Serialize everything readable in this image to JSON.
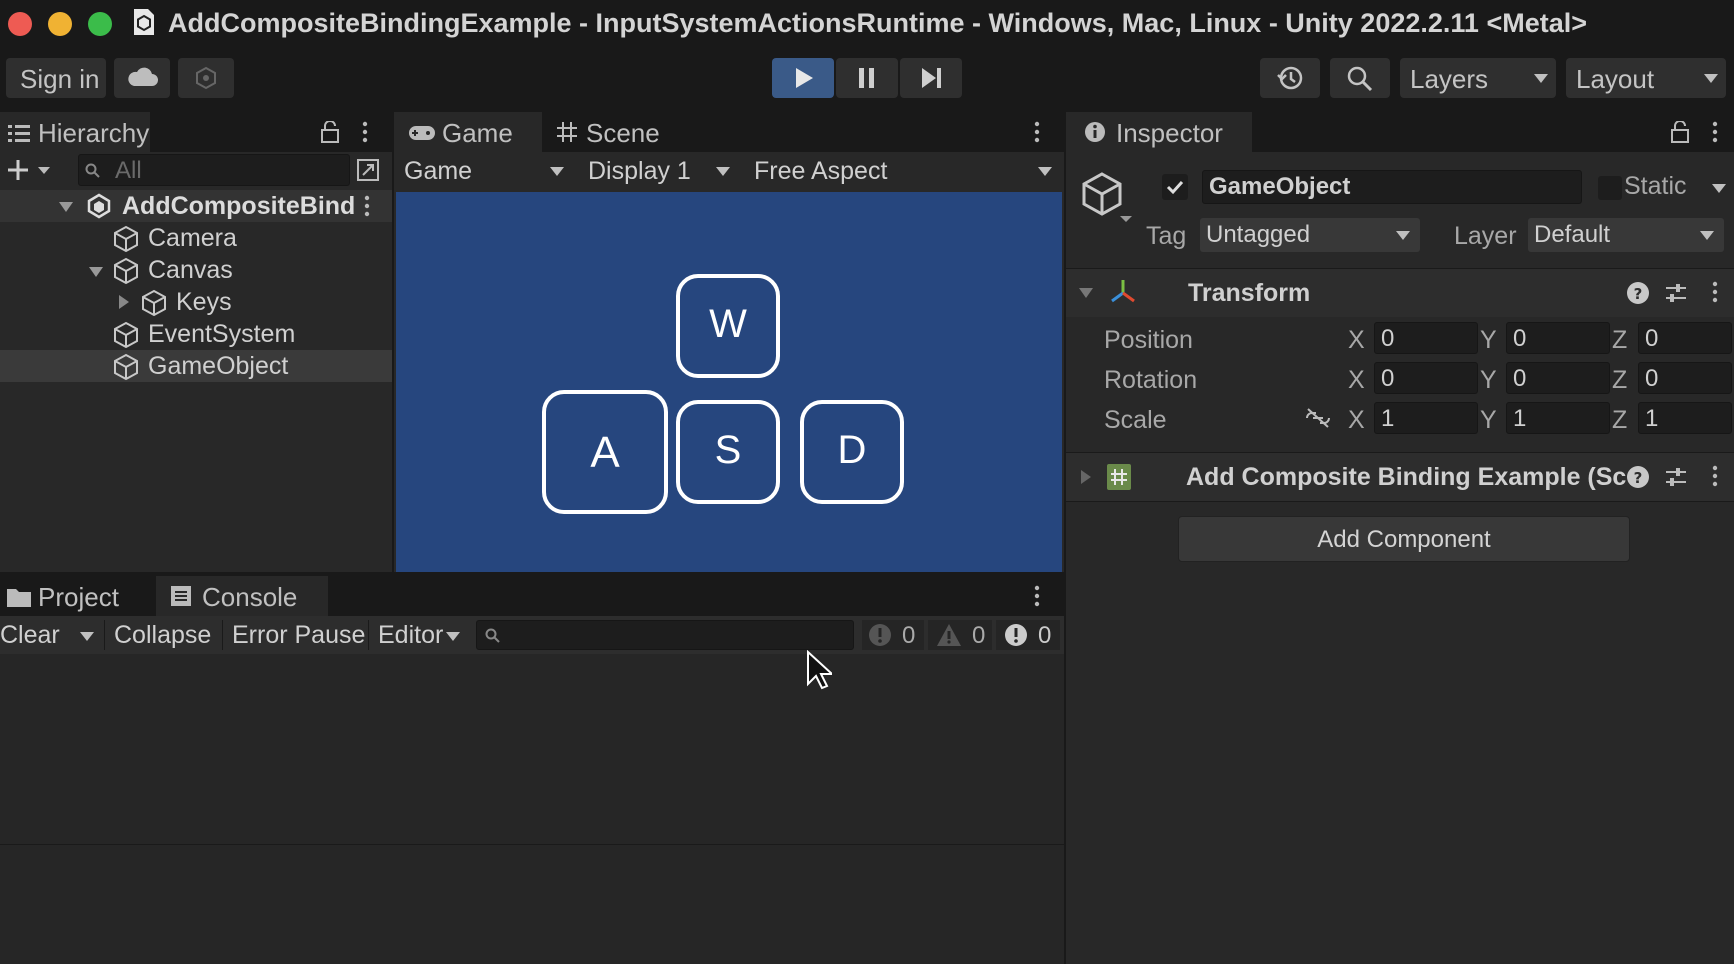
{
  "window": {
    "title": "AddCompositeBindingExample - InputSystemActionsRuntime - Windows, Mac, Linux - Unity 2022.2.11 <Metal>"
  },
  "toolbar": {
    "sign_in": "Sign in",
    "layers": "Layers",
    "layout": "Layout"
  },
  "hierarchy": {
    "tab": "Hierarchy",
    "search_placeholder": "All",
    "scene": "AddCompositeBind",
    "items": [
      "Camera",
      "Canvas",
      "Keys",
      "EventSystem",
      "GameObject"
    ]
  },
  "game": {
    "tab_game": "Game",
    "tab_scene": "Scene",
    "view_mode": "Game",
    "display": "Display 1",
    "aspect": "Free Aspect",
    "keys": {
      "w": "W",
      "a": "A",
      "s": "S",
      "d": "D"
    },
    "view_bg": "#26467e"
  },
  "inspector": {
    "tab": "Inspector",
    "object_name": "GameObject",
    "static_label": "Static",
    "tag_label": "Tag",
    "tag_value": "Untagged",
    "layer_label": "Layer",
    "layer_value": "Default",
    "transform_title": "Transform",
    "rows": [
      {
        "label": "Position",
        "x": "0",
        "y": "0",
        "z": "0"
      },
      {
        "label": "Rotation",
        "x": "0",
        "y": "0",
        "z": "0"
      },
      {
        "label": "Scale",
        "x": "1",
        "y": "1",
        "z": "1"
      }
    ],
    "axis": {
      "x": "X",
      "y": "Y",
      "z": "Z"
    },
    "script_component": "Add Composite Binding Example (Sc",
    "add_component": "Add Component"
  },
  "console": {
    "tab_project": "Project",
    "tab_console": "Console",
    "clear": "Clear",
    "collapse": "Collapse",
    "error_pause": "Error Pause",
    "editor": "Editor",
    "count_info": "0",
    "count_warn": "0",
    "count_error": "0"
  },
  "colors": {
    "play_active": "#3a5a88",
    "game_view": "#26467e"
  }
}
